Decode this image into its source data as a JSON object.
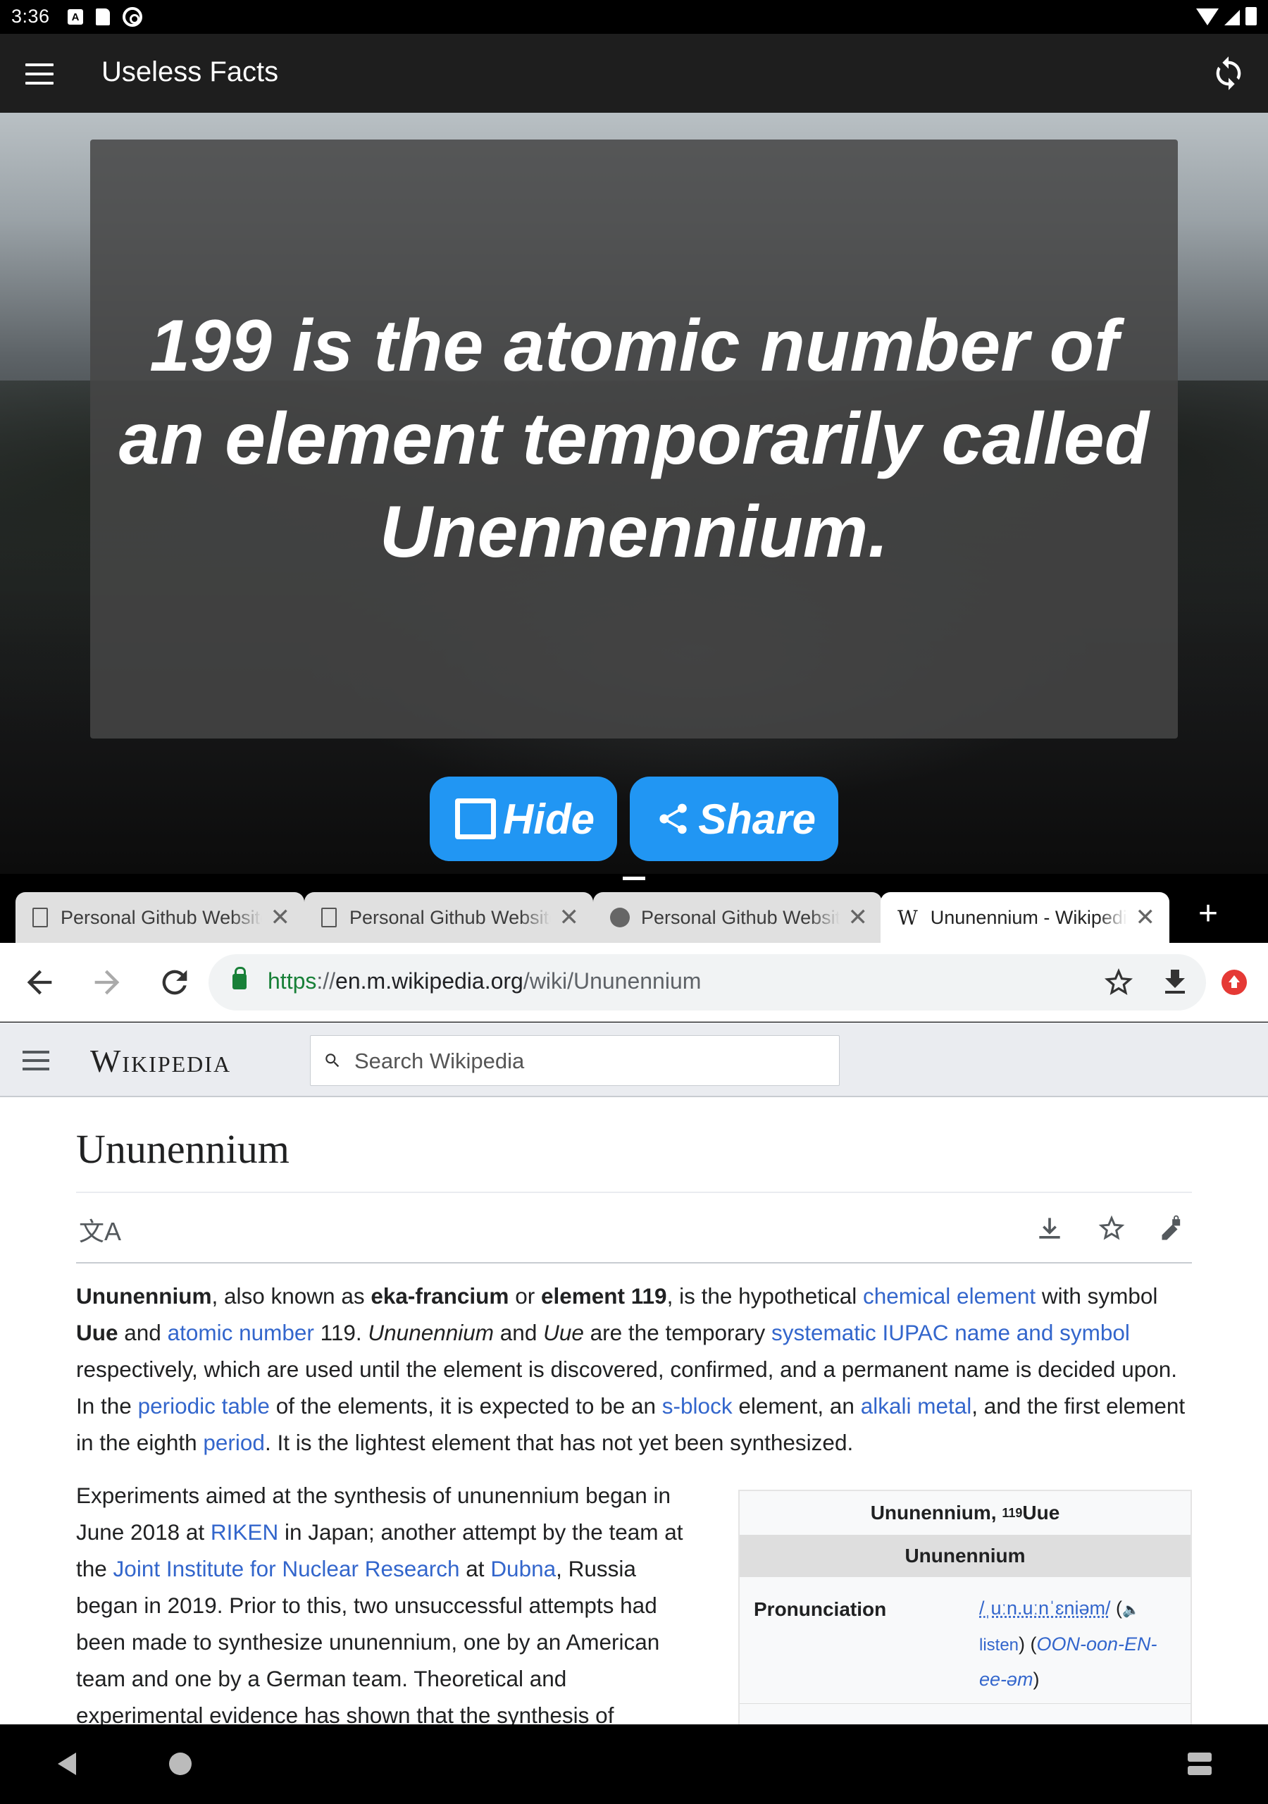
{
  "status_bar": {
    "time": "3:36",
    "a_icon": "A"
  },
  "app": {
    "title": "Useless Facts",
    "menu_icon": "hamburger-menu-icon",
    "refresh_icon": "sync-icon"
  },
  "fact": {
    "text": "199 is the atomic number of an element temporarily called Unennennium.",
    "hide_label": "Hide",
    "share_label": "Share",
    "button_color": "#2196f3"
  },
  "browser": {
    "tabs": [
      {
        "title": "Personal Github Website",
        "icon": "page-icon",
        "active": false
      },
      {
        "title": "Personal Github Website",
        "icon": "page-icon",
        "active": false
      },
      {
        "title": "Personal Github Website",
        "icon": "globe-icon",
        "active": false
      },
      {
        "title": "Ununennium - Wikipedia",
        "icon": "wikipedia-w-icon",
        "active": true
      }
    ],
    "new_tab_label": "+",
    "wiki_w": "W",
    "close_glyph": "✕",
    "url_scheme": "https",
    "url_sep": "://",
    "url_host": "en.m.wikipedia.org",
    "url_path": "/wiki/Ununennium"
  },
  "wiki": {
    "logo": "Wikipedia",
    "search_placeholder": "Search Wikipedia",
    "title": "Ununennium",
    "lang_icon": "文A",
    "p1": [
      {
        "t": "Ununennium",
        "s": "b"
      },
      {
        "t": ", also known as ",
        "s": ""
      },
      {
        "t": "eka-francium",
        "s": "b"
      },
      {
        "t": " or ",
        "s": ""
      },
      {
        "t": "element 119",
        "s": "b"
      },
      {
        "t": ", is the hypothetical ",
        "s": ""
      },
      {
        "t": "chemical element",
        "s": "a"
      },
      {
        "t": " with symbol ",
        "s": ""
      },
      {
        "t": "Uue",
        "s": "b"
      },
      {
        "t": " and ",
        "s": ""
      },
      {
        "t": "atomic number",
        "s": "a"
      },
      {
        "t": " 119. ",
        "s": ""
      },
      {
        "t": "Ununennium",
        "s": "i"
      },
      {
        "t": " and ",
        "s": ""
      },
      {
        "t": "Uue",
        "s": "i"
      },
      {
        "t": " are the temporary ",
        "s": ""
      },
      {
        "t": "systematic IUPAC name and symbol",
        "s": "a"
      },
      {
        "t": " respectively, which are used until the element is discovered, confirmed, and a permanent name is decided upon. In the ",
        "s": ""
      },
      {
        "t": "periodic table",
        "s": "a"
      },
      {
        "t": " of the elements, it is expected to be an ",
        "s": ""
      },
      {
        "t": "s-block",
        "s": "a"
      },
      {
        "t": " element, an ",
        "s": ""
      },
      {
        "t": "alkali metal",
        "s": "a"
      },
      {
        "t": ", and the first element in the eighth ",
        "s": ""
      },
      {
        "t": "period",
        "s": "a"
      },
      {
        "t": ". It is the lightest element that has not yet been synthesized.",
        "s": ""
      }
    ],
    "p2": [
      {
        "t": "Experiments aimed at the synthesis of ununennium began in June 2018 at ",
        "s": ""
      },
      {
        "t": "RIKEN",
        "s": "a"
      },
      {
        "t": " in Japan; another attempt by the team at the ",
        "s": ""
      },
      {
        "t": "Joint Institute for Nuclear Research",
        "s": "a"
      },
      {
        "t": " at ",
        "s": ""
      },
      {
        "t": "Dubna",
        "s": "a"
      },
      {
        "t": ", Russia began in 2019. Prior to this, two unsuccessful attempts had been made to synthesize ununennium, one by an American team and one by a German team. Theoretical and experimental evidence has shown that the synthesis of",
        "s": ""
      }
    ],
    "infobox": {
      "title_pre": "Ununennium, ",
      "title_sub": "119",
      "title_sym": "Uue",
      "header": "Ununennium",
      "pron_label": "Pronunciation",
      "pron_ipa": "/ˌuːn.uːnˈɛniəm/",
      "pron_open": " (",
      "pron_listen": "listen",
      "pron_mid": ") (",
      "pron_resp": "OON-oon-EN-ee-əm",
      "pron_close": ")"
    }
  }
}
